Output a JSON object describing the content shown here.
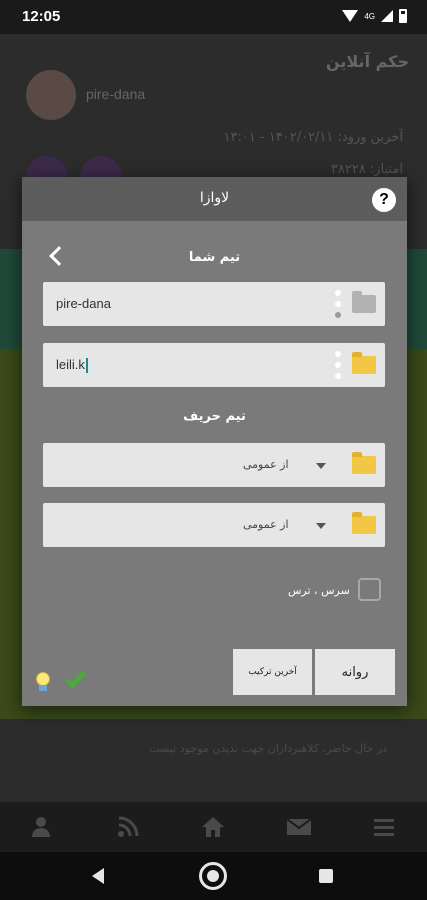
{
  "status_bar": {
    "time": "12:05",
    "network": "4G"
  },
  "background": {
    "title": "حکم آنلاین",
    "username": "pire-dana",
    "last_login": "آخرین ورود: ۱۴۰۲/۰۲/۱۱ - ۱۳:۰۱",
    "points": "امتیاز: ۳۸۲۲۸",
    "note": "در حال حاضر، کلاهبرداران جهت ندیدن موجود نیست"
  },
  "dialog": {
    "title": "لاوازا",
    "help_label": "?",
    "your_team": {
      "title": "تیم شما",
      "player1": "pire-dana",
      "player2": "leili.k"
    },
    "opponent_team": {
      "title": "تیم حریف",
      "player1_select": "از عمومی",
      "player2_select": "از عمومی"
    },
    "checkbox_label": "سرس ، ترس",
    "checkbox_checked": false,
    "buttons": {
      "last_combo": "آخرین ترکیب",
      "send": "روانه"
    }
  },
  "icons": {
    "bottom_nav": [
      "user-icon",
      "rss-icon",
      "home-icon",
      "mail-icon",
      "menu-icon"
    ],
    "colors": {
      "folder_active": "#f2c744",
      "folder_inactive": "#b3b3b3",
      "check": "#4aaa3a"
    }
  }
}
